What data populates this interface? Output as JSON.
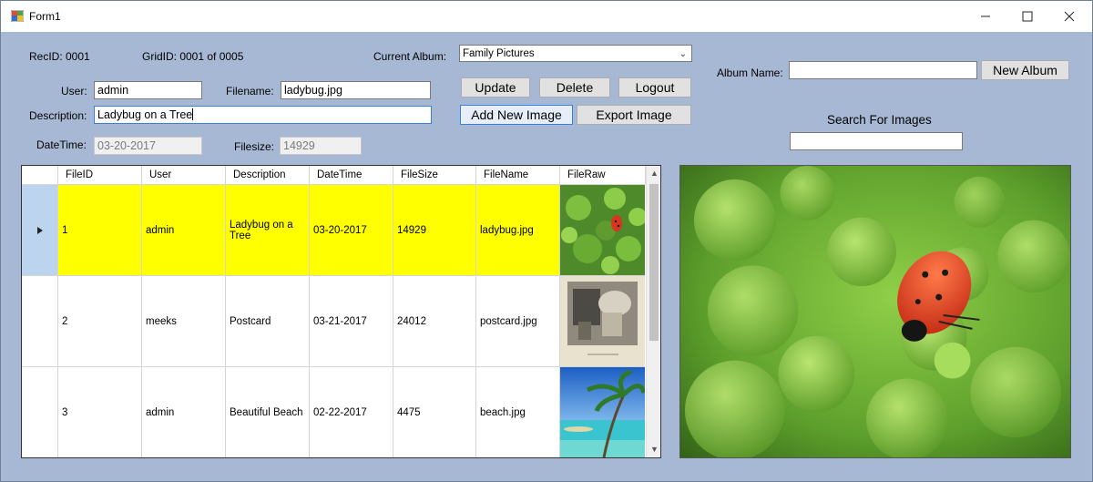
{
  "window": {
    "title": "Form1"
  },
  "form": {
    "recid_label": "RecID: 0001",
    "gridid_label": "GridID: 0001 of 0005",
    "current_album_label": "Current Album:",
    "current_album_value": "Family Pictures",
    "user_label": "User:",
    "user_value": "admin",
    "filename_label": "Filename:",
    "filename_value": "ladybug.jpg",
    "description_label": "Description:",
    "description_value": "Ladybug on a Tree",
    "datetime_label": "DateTime:",
    "datetime_value": "03-20-2017",
    "filesize_label": "Filesize:",
    "filesize_value": "14929"
  },
  "buttons": {
    "update": "Update",
    "delete": "Delete",
    "logout": "Logout",
    "add_new_image": "Add New Image",
    "export_image": "Export Image",
    "new_album": "New Album"
  },
  "album": {
    "label": "Album Name:",
    "value": ""
  },
  "search": {
    "label": "Search For Images",
    "value": ""
  },
  "grid": {
    "columns": [
      "FileID",
      "User",
      "Description",
      "DateTime",
      "FileSize",
      "FileName",
      "FileRaw"
    ],
    "rows": [
      {
        "id": "1",
        "user": "admin",
        "description": "Ladybug on a Tree",
        "datetime": "03-20-2017",
        "size": "14929",
        "name": "ladybug.jpg",
        "thumb": "ladybug"
      },
      {
        "id": "2",
        "user": "meeks",
        "description": "Postcard",
        "datetime": "03-21-2017",
        "size": "24012",
        "name": "postcard.jpg",
        "thumb": "postcard"
      },
      {
        "id": "3",
        "user": "admin",
        "description": "Beautiful Beach",
        "datetime": "02-22-2017",
        "size": "4475",
        "name": "beach.jpg",
        "thumb": "beach"
      }
    ]
  },
  "colors": {
    "form_bg": "#a7b8d4",
    "selected_row": "#ffff00",
    "focus_border": "#3c7fd8"
  }
}
